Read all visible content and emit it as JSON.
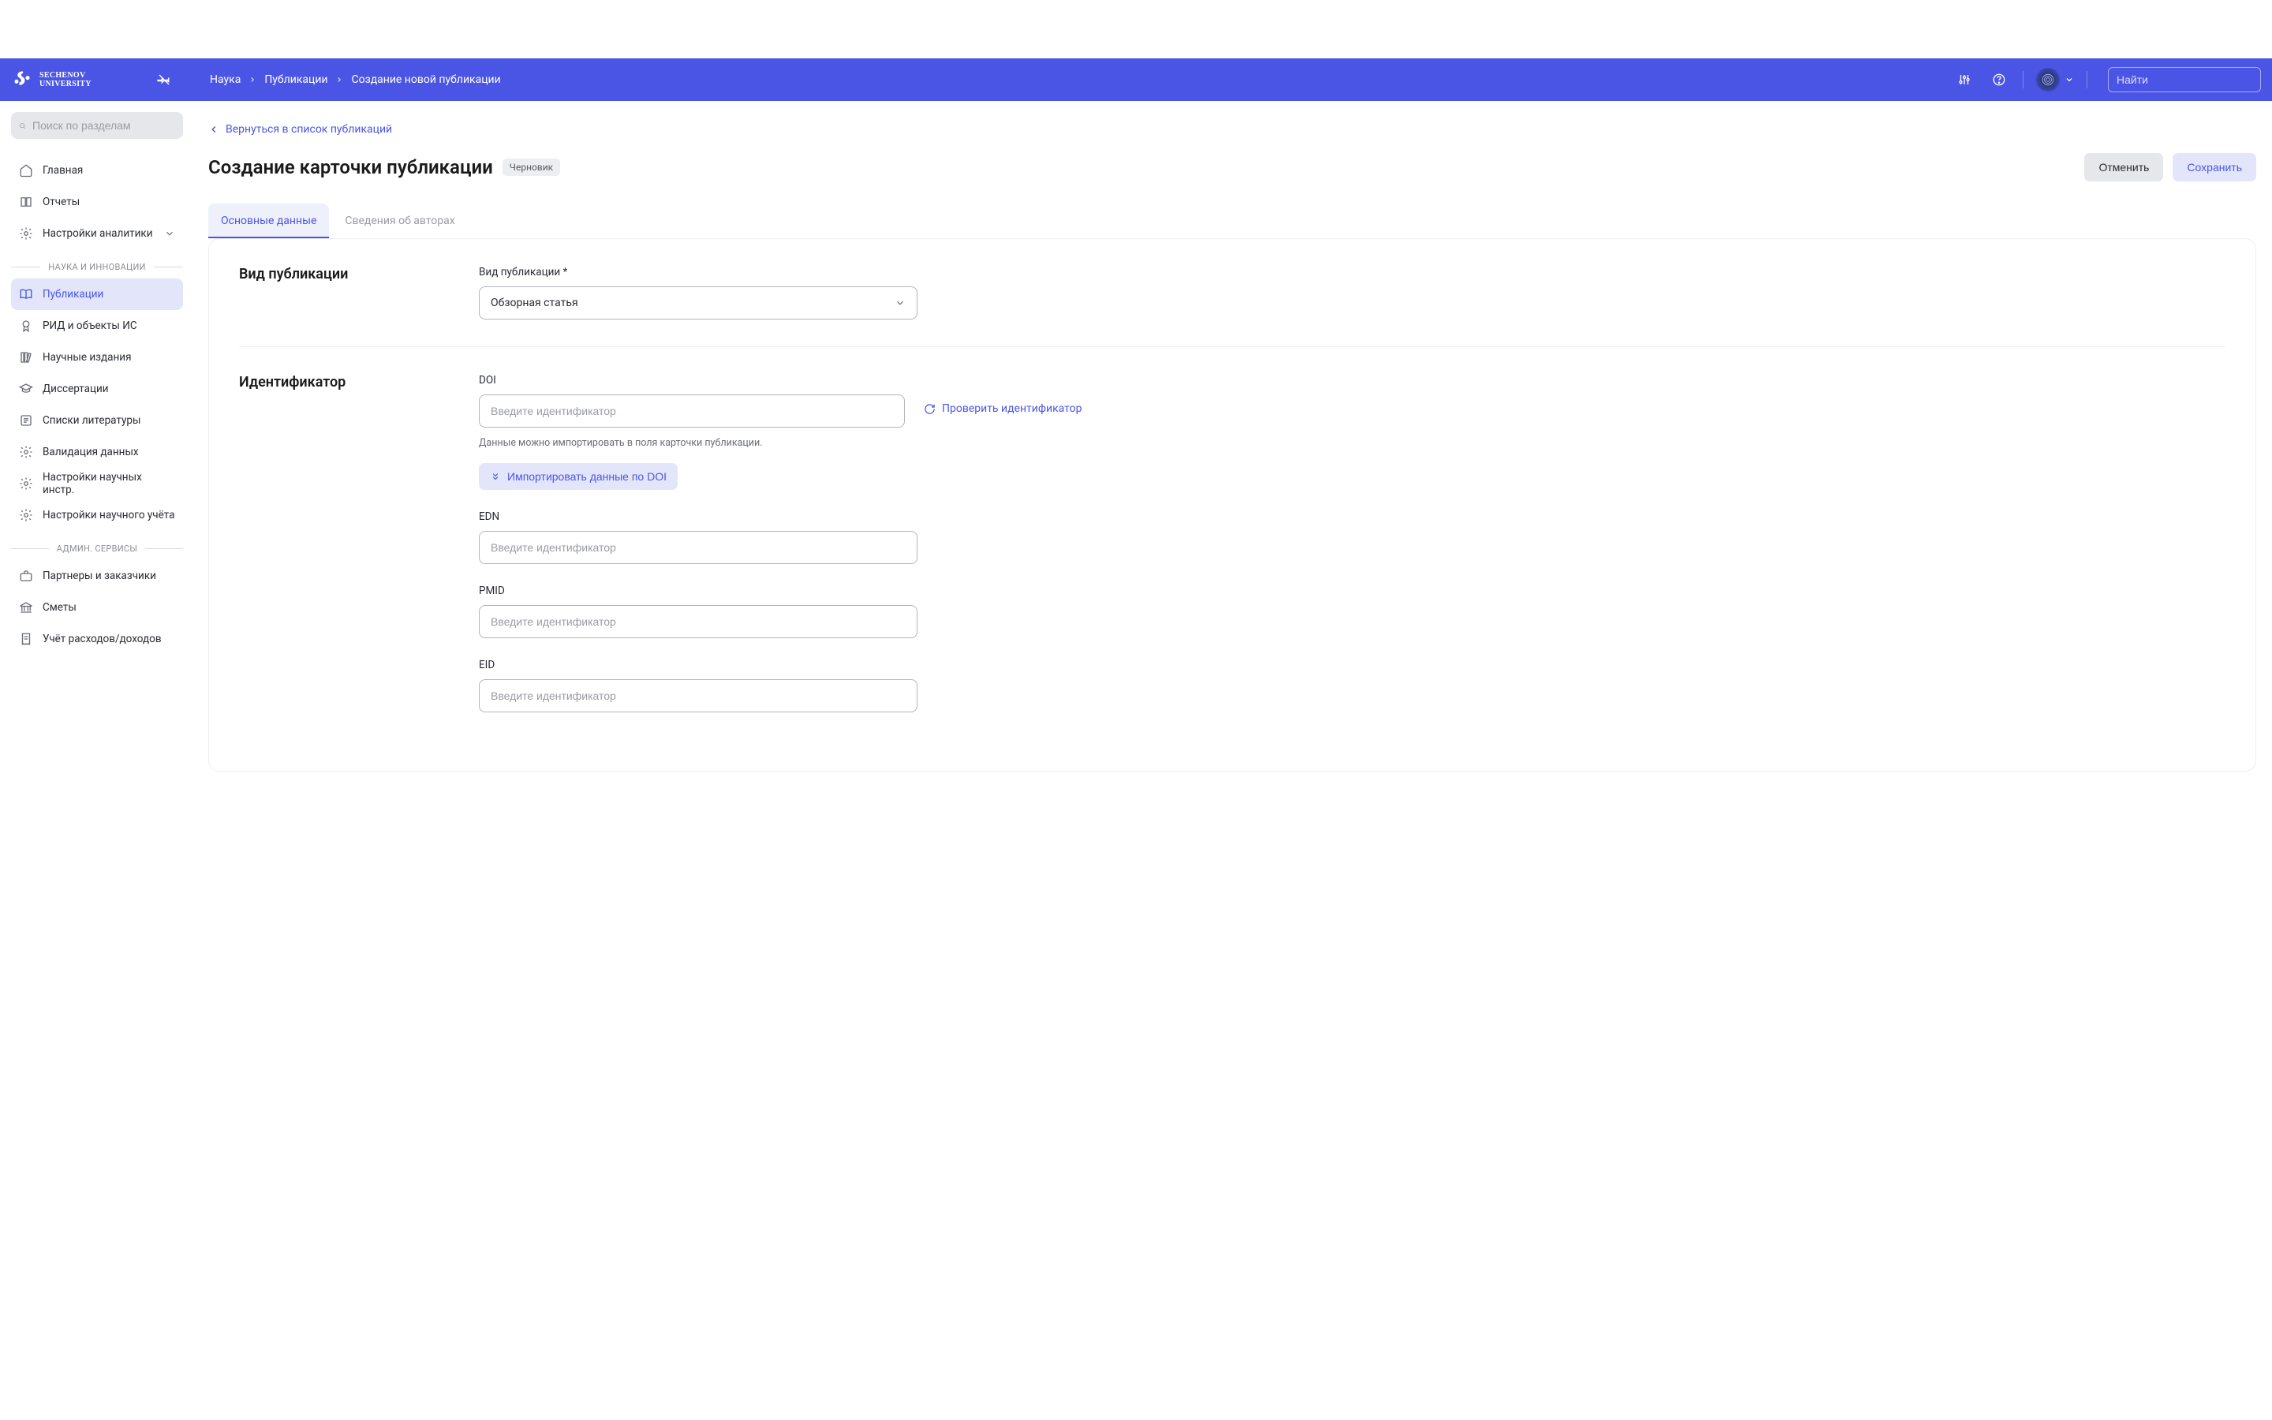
{
  "logo": {
    "line1": "SECHENOV",
    "line2": "UNIVERSITY"
  },
  "breadcrumb": {
    "a": "Наука",
    "b": "Публикации",
    "c": "Создание новой публикации"
  },
  "top_search_placeholder": "Найти",
  "sidebar": {
    "search_placeholder": "Поиск по разделам",
    "items": {
      "home": "Главная",
      "reports": "Отчеты",
      "analytics": "Настройки аналитики"
    },
    "section_science": "НАУКА И ИННОВАЦИИ",
    "science": {
      "publications": "Публикации",
      "rid": "РИД и объекты ИС",
      "journals": "Научные издания",
      "dissertations": "Диссертации",
      "biblists": "Списки литературы",
      "validation": "Валидация данных",
      "instr": "Настройки научных инстр.",
      "accounting": "Настройки научного учёта"
    },
    "section_admin": "АДМИН. СЕРВИСЫ",
    "admin": {
      "partners": "Партнеры и заказчики",
      "estimates": "Сметы",
      "expenses": "Учёт расходов/доходов"
    }
  },
  "back_link": "Вернуться в список публикаций",
  "page_title": "Создание карточки публикации",
  "badge_draft": "Черновик",
  "actions": {
    "cancel": "Отменить",
    "save": "Сохранить"
  },
  "tabs": {
    "main": "Основные данные",
    "authors": "Сведения об авторах"
  },
  "sections": {
    "kind": {
      "title": "Вид публикации",
      "field_label": "Вид публикации *",
      "value": "Обзорная статья"
    },
    "identifier": {
      "title": "Идентификатор",
      "doi_label": "DOI",
      "placeholder": "Введите идентификатор",
      "verify": "Проверить идентификатор",
      "helper": "Данные можно импортировать в поля карточки публикации.",
      "import": "Импортировать данные по DOI",
      "edn_label": "EDN",
      "pmid_label": "PMID",
      "eid_label": "EID",
      "pmid_placeholder": "Введите идентификатор",
      "eid_placeholder": "Введите идентификатор"
    }
  }
}
